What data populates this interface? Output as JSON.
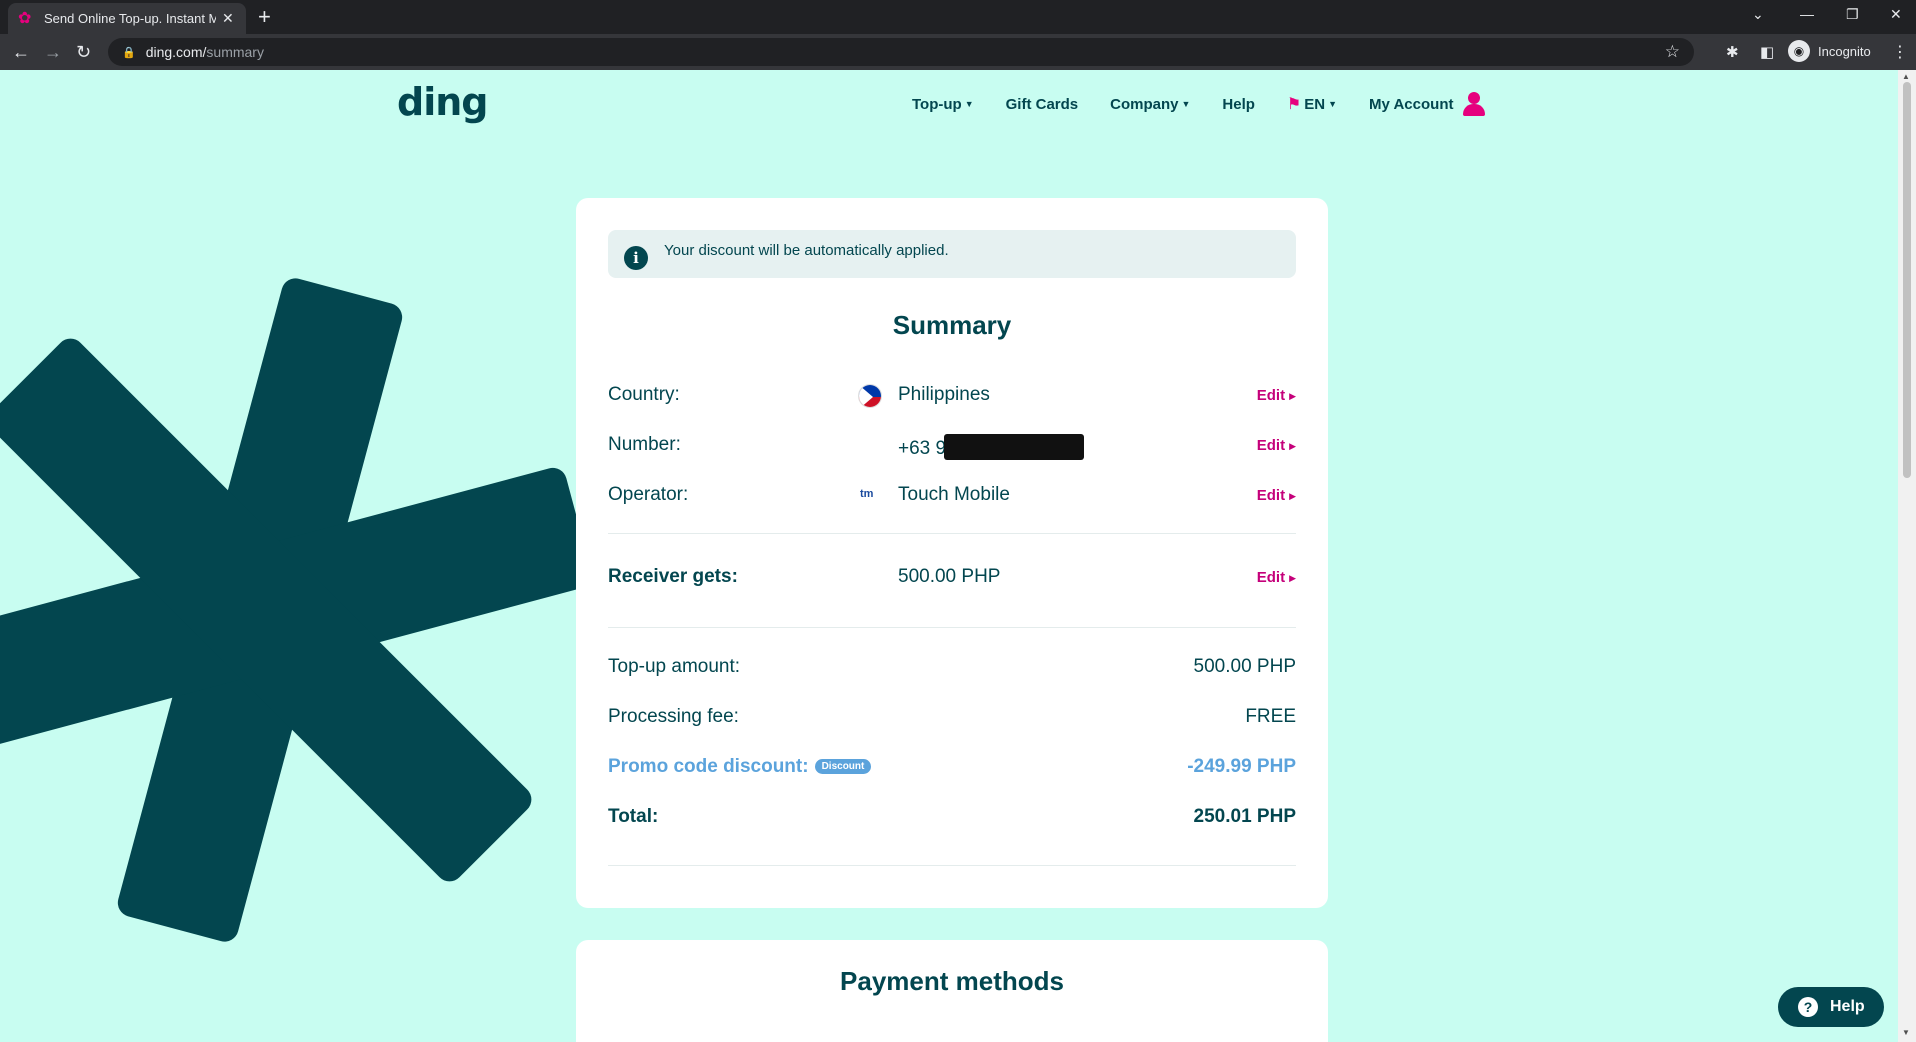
{
  "browser": {
    "tab_title": "Send Online Top-up. Instant Mobile",
    "tab_favicon": "ding-flower-icon",
    "url_host": "ding.com/",
    "url_path": "summary",
    "profile_label": "Incognito"
  },
  "header": {
    "logo": "ding",
    "nav": {
      "topup": "Top-up",
      "gift_cards": "Gift Cards",
      "company": "Company",
      "help": "Help",
      "language": "EN",
      "my_account": "My Account"
    }
  },
  "notice": {
    "text": "Your discount will be automatically applied."
  },
  "summary": {
    "title": "Summary",
    "country_label": "Country:",
    "country_value": "Philippines",
    "number_label": "Number:",
    "number_value": "+63 9",
    "operator_label": "Operator:",
    "operator_value": "Touch Mobile",
    "operator_logo": "tm",
    "receiver_label": "Receiver gets:",
    "receiver_value": "500.00 PHP",
    "edit_label": "Edit",
    "topup_label": "Top-up amount:",
    "topup_value": "500.00 PHP",
    "fee_label": "Processing fee:",
    "fee_value": "FREE",
    "promo_label": "Promo code discount:",
    "promo_badge": "Discount",
    "promo_value": "-249.99 PHP",
    "total_label": "Total:",
    "total_value": "250.01 PHP"
  },
  "payment": {
    "title": "Payment methods"
  },
  "help_button": {
    "label": "Help"
  },
  "colors": {
    "page_bg": "#c8fdf1",
    "brand_dark": "#03464f",
    "accent_magenta": "#c5007a",
    "promo_blue": "#5ba3dc"
  }
}
